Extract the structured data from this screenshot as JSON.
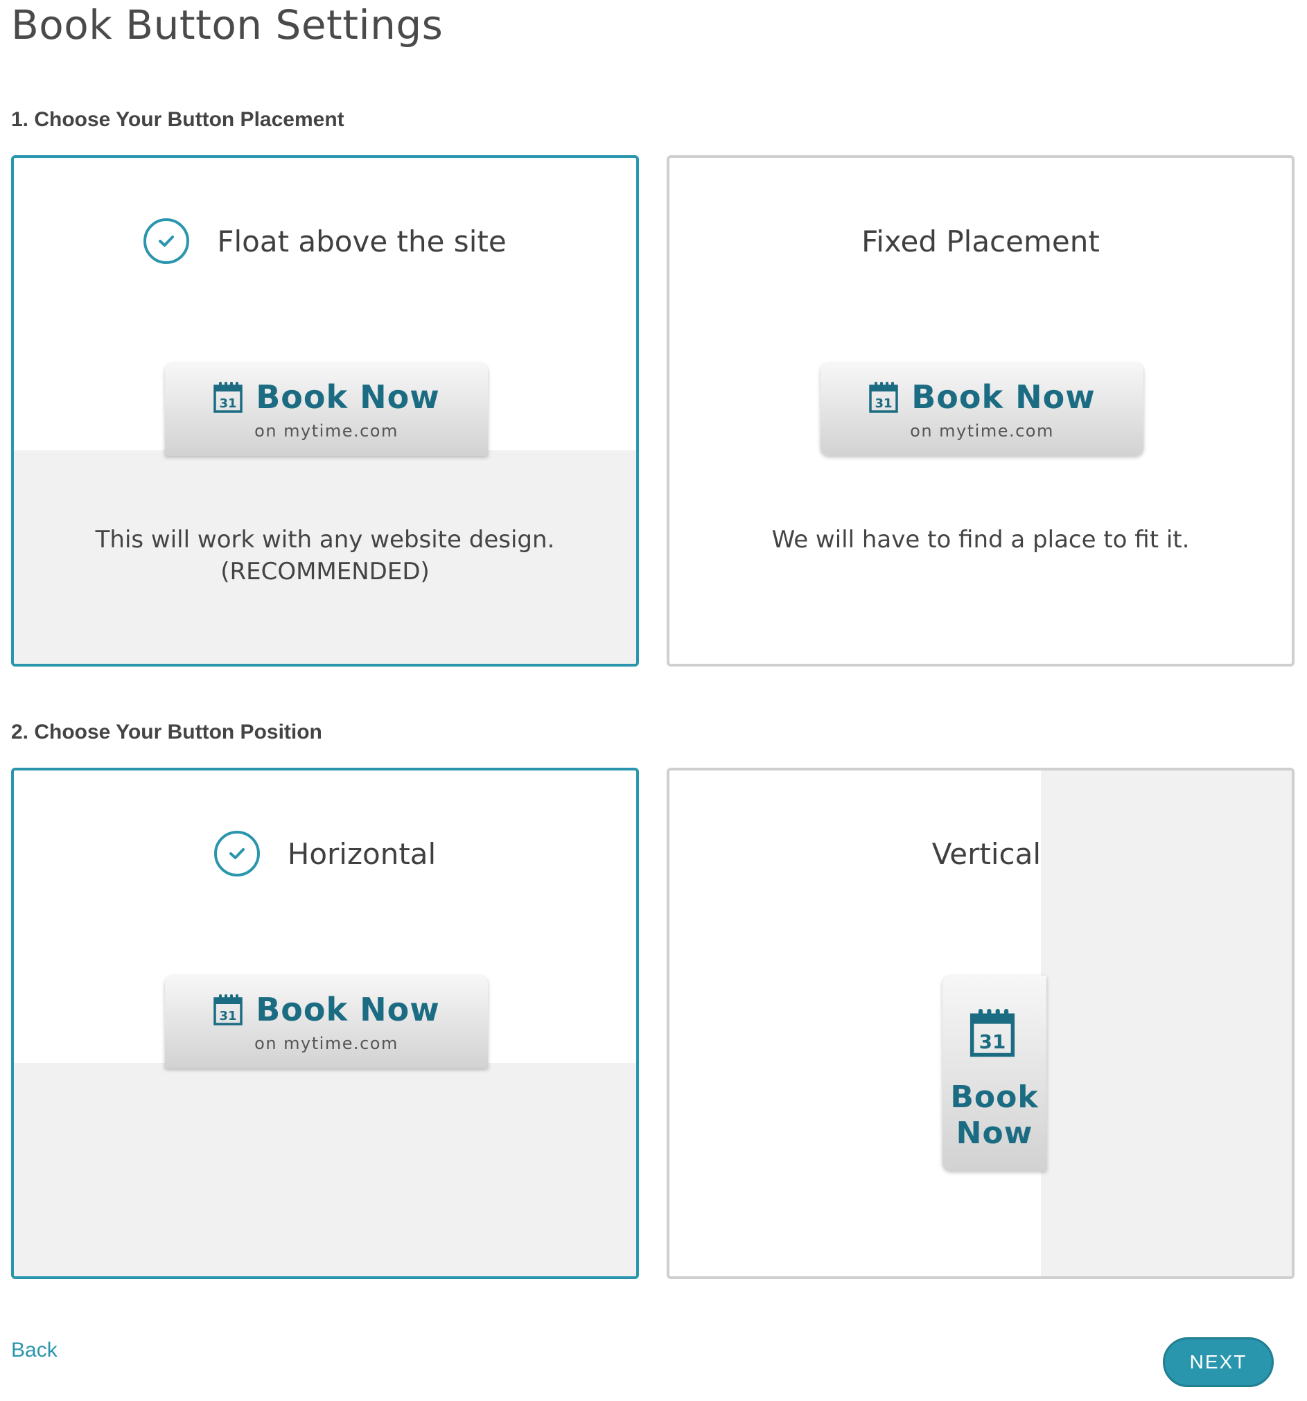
{
  "page": {
    "title": "Book Button Settings"
  },
  "section1": {
    "heading": "1. Choose Your Button Placement",
    "options": [
      {
        "title": "Float above the site",
        "selected": true,
        "button_label": "Book Now",
        "button_sub": "on mytime.com",
        "desc_line1": "This will work with any website design.",
        "desc_line2": "(RECOMMENDED)"
      },
      {
        "title": "Fixed Placement",
        "selected": false,
        "button_label": "Book Now",
        "button_sub": "on mytime.com",
        "desc_line1": "We will have to find a place to fit it."
      }
    ]
  },
  "section2": {
    "heading": "2. Choose Your Button Position",
    "options": [
      {
        "title": "Horizontal",
        "selected": true,
        "button_label": "Book Now",
        "button_sub": "on mytime.com"
      },
      {
        "title": "Vertical",
        "selected": false,
        "button_line1": "Book",
        "button_line2": "Now"
      }
    ]
  },
  "calendar_day": "31",
  "footer": {
    "back_label": "Back",
    "next_label": "NEXT"
  },
  "colors": {
    "accent": "#2a96ad",
    "button_text": "#1b6c82",
    "panel_fill": "#f1f1f1"
  }
}
